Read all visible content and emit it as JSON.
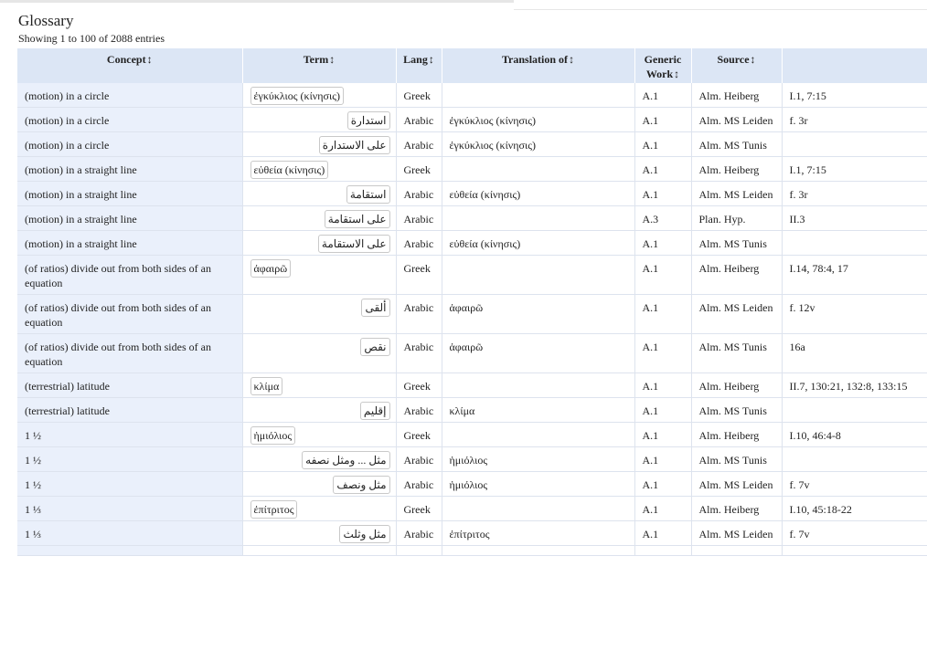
{
  "page": {
    "title": "Glossary",
    "info": "Showing 1 to 100 of 2088 entries"
  },
  "columns": [
    {
      "label": "Concept",
      "sort": "↕"
    },
    {
      "label": "Term",
      "sort": "↕"
    },
    {
      "label": "Lang",
      "sort": "↕"
    },
    {
      "label": "Translation of",
      "sort": "↕"
    },
    {
      "label": "Generic Work",
      "sort": "↕"
    },
    {
      "label": "Source",
      "sort": "↕"
    },
    {
      "label": "",
      "sort": ""
    }
  ],
  "rows": [
    {
      "concept": "(motion) in a circle",
      "term": "ἐγκύκλιος (κίνησις)",
      "lang": "Greek",
      "translation_of": "",
      "work": "A.1",
      "source": "Alm. Heiberg",
      "ref": "I.1, 7:15"
    },
    {
      "concept": "(motion) in a circle",
      "term": "استدارة",
      "lang": "Arabic",
      "translation_of": "ἐγκύκλιος (κίνησις)",
      "work": "A.1",
      "source": "Alm. MS Leiden",
      "ref": "f. 3r"
    },
    {
      "concept": "(motion) in a circle",
      "term": "على الاستدارة",
      "lang": "Arabic",
      "translation_of": "ἐγκύκλιος (κίνησις)",
      "work": "A.1",
      "source": "Alm. MS Tunis",
      "ref": ""
    },
    {
      "concept": "(motion) in a straight line",
      "term": "εὐθεία (κίνησις)",
      "lang": "Greek",
      "translation_of": "",
      "work": "A.1",
      "source": "Alm. Heiberg",
      "ref": "I.1, 7:15"
    },
    {
      "concept": "(motion) in a straight line",
      "term": "استقامة",
      "lang": "Arabic",
      "translation_of": "εὐθεία (κίνησις)",
      "work": "A.1",
      "source": "Alm. MS Leiden",
      "ref": "f. 3r"
    },
    {
      "concept": "(motion) in a straight line",
      "term": "على استقامة",
      "lang": "Arabic",
      "translation_of": "",
      "work": "A.3",
      "source": "Plan. Hyp.",
      "ref": "II.3"
    },
    {
      "concept": "(motion) in a straight line",
      "term": "على الاستقامة",
      "lang": "Arabic",
      "translation_of": "εὐθεία (κίνησις)",
      "work": "A.1",
      "source": "Alm. MS Tunis",
      "ref": ""
    },
    {
      "concept": "(of ratios) divide out from both sides of an equation",
      "term": "ἀφαιρῶ",
      "lang": "Greek",
      "translation_of": "",
      "work": "A.1",
      "source": "Alm. Heiberg",
      "ref": "I.14, 78:4, 17"
    },
    {
      "concept": "(of ratios) divide out from both sides of an equation",
      "term": "ألقى",
      "lang": "Arabic",
      "translation_of": "ἀφαιρῶ",
      "work": "A.1",
      "source": "Alm. MS Leiden",
      "ref": "f. 12v"
    },
    {
      "concept": "(of ratios) divide out from both sides of an equation",
      "term": "نقص",
      "lang": "Arabic",
      "translation_of": "ἀφαιρῶ",
      "work": "A.1",
      "source": "Alm. MS Tunis",
      "ref": "16a"
    },
    {
      "concept": "(terrestrial) latitude",
      "term": "κλίμα",
      "lang": "Greek",
      "translation_of": "",
      "work": "A.1",
      "source": "Alm. Heiberg",
      "ref": "II.7, 130:21, 132:8, 133:15"
    },
    {
      "concept": "(terrestrial) latitude",
      "term": "إقليم",
      "lang": "Arabic",
      "translation_of": "κλίμα",
      "work": "A.1",
      "source": "Alm. MS Tunis",
      "ref": ""
    },
    {
      "concept": "1 ½",
      "term": "ἡμιόλιος",
      "lang": "Greek",
      "translation_of": "",
      "work": "A.1",
      "source": "Alm. Heiberg",
      "ref": "I.10, 46:4-8"
    },
    {
      "concept": "1 ½",
      "term": "مثل ... ومثل نصفه",
      "lang": "Arabic",
      "translation_of": "ἡμιόλιος",
      "work": "A.1",
      "source": "Alm. MS Tunis",
      "ref": ""
    },
    {
      "concept": "1 ½",
      "term": "مثل ونصف",
      "lang": "Arabic",
      "translation_of": "ἡμιόλιος",
      "work": "A.1",
      "source": "Alm. MS Leiden",
      "ref": "f. 7v"
    },
    {
      "concept": "1 ⅓",
      "term": "ἐπίτριτος",
      "lang": "Greek",
      "translation_of": "",
      "work": "A.1",
      "source": "Alm. Heiberg",
      "ref": "I.10, 45:18-22"
    },
    {
      "concept": "1 ⅓",
      "term": "مثل وثلث",
      "lang": "Arabic",
      "translation_of": "ἐπίτριτος",
      "work": "A.1",
      "source": "Alm. MS Leiden",
      "ref": "f. 7v"
    },
    {
      "concept": "",
      "term": "",
      "lang": "",
      "translation_of": "",
      "work": "",
      "source": "",
      "ref": ""
    }
  ]
}
